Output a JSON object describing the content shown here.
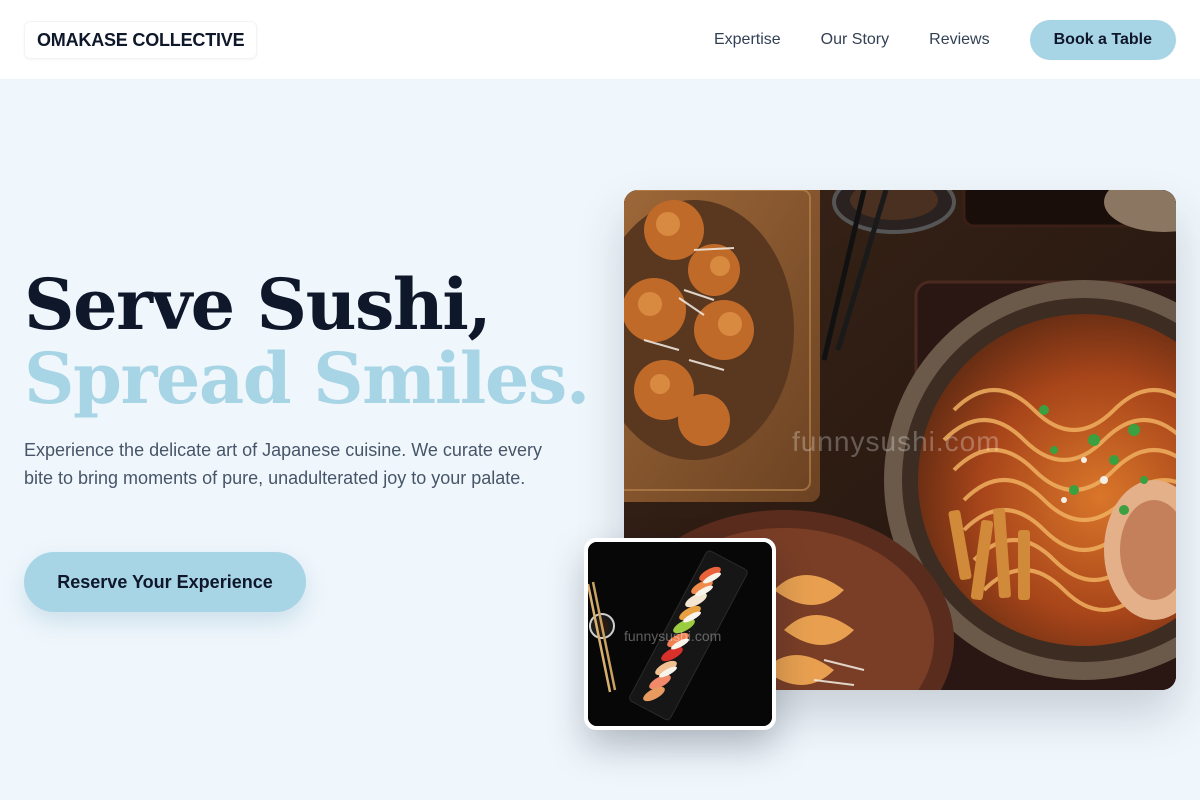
{
  "header": {
    "logo": "OMAKASE COLLECTIVE",
    "nav": [
      {
        "label": "Expertise"
      },
      {
        "label": "Our Story"
      },
      {
        "label": "Reviews"
      }
    ],
    "cta": "Book a Table"
  },
  "hero": {
    "title_line1": "Serve Sushi,",
    "title_line2": "Spread Smiles.",
    "subtitle": "Experience the delicate art of Japanese cuisine. We curate every bite to bring moments of pure, unadulterated joy to your palate.",
    "cta": "Reserve Your Experience"
  },
  "images": {
    "main_watermark": "funnysushi.com",
    "thumb_watermark": "funnysushi.com"
  },
  "colors": {
    "accent": "#a8d5e5",
    "dark_text": "#0f172a",
    "body_text": "#475569",
    "background": "#f0f7fc"
  }
}
